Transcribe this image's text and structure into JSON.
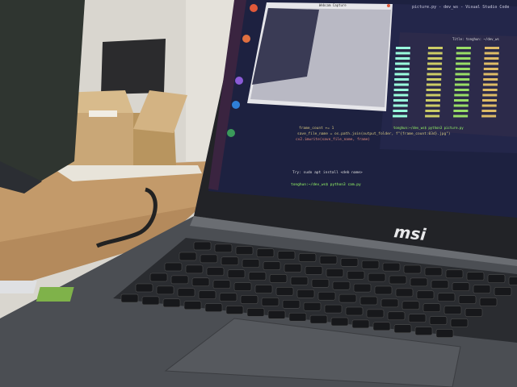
{
  "scene": {
    "description_labels": {
      "brand_logo": "msi"
    },
    "screen": {
      "webcam_window_title": "Webcam Capture",
      "editor_window_title": "picture.py - dev_ws - Visual Studio Code",
      "terminal_title": "Title: tonghun: ~/dev_ws",
      "code_lines": [
        "frame_count += 1",
        "save_file_name = os.path.join(output_folder, f\"{frame_count:03d}.jpg\")",
        "cv2.imwrite(save_file_name, frame)"
      ],
      "terminal_lines": [
        "Try: sudo apt install <deb name>",
        "tonghun:~/dev_ws$ python3 cam.py"
      ],
      "terminal_prompt": "tonghun:~/dev_ws$ python3 picture.py"
    },
    "colors": {
      "wall": "#d9d6cf",
      "desk": "#c39a6a",
      "laptop_body": "#4b4e53",
      "screen_bg": "#1d2140",
      "cardboard": "#c9a777"
    }
  }
}
